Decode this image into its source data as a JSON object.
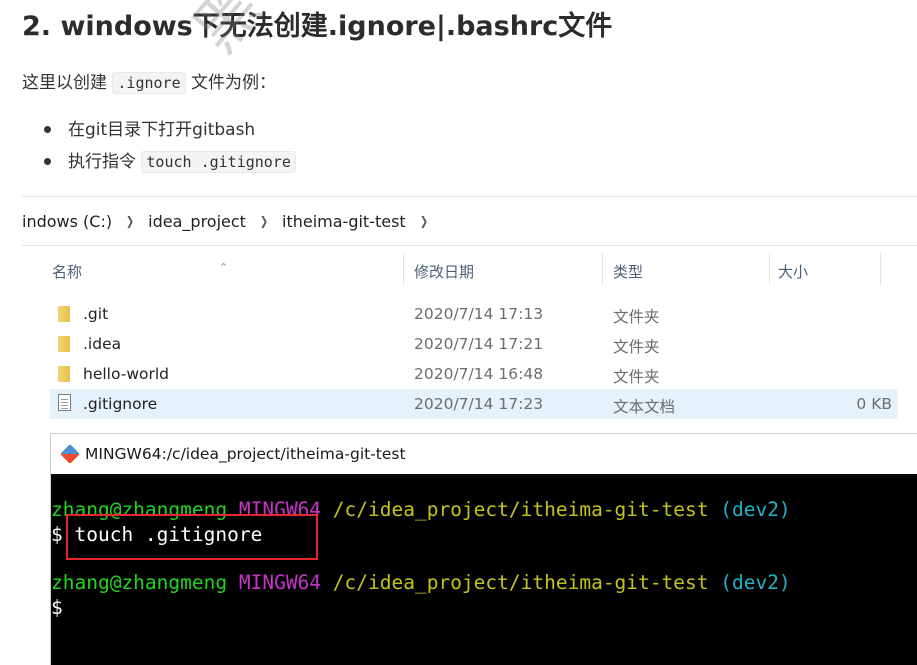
{
  "heading": "2. windows下无法创建.ignore|.bashrc文件",
  "intro": {
    "before": "这里以创建 ",
    "code": ".ignore",
    "after": " 文件为例："
  },
  "bullets": [
    {
      "text": "在git目录下打开gitbash",
      "code": ""
    },
    {
      "text": "执行指令 ",
      "code": "touch .gitignore"
    }
  ],
  "watermark": "黑马程序",
  "explorer": {
    "breadcrumb": [
      "indows (C:)",
      "idea_project",
      "itheima-git-test"
    ],
    "columns": {
      "name": "名称",
      "date": "修改日期",
      "type": "类型",
      "size": "大小"
    },
    "rows": [
      {
        "name": ".git",
        "date": "2020/7/14 17:13",
        "type": "文件夹",
        "size": "",
        "kind": "folder"
      },
      {
        "name": ".idea",
        "date": "2020/7/14 17:21",
        "type": "文件夹",
        "size": "",
        "kind": "folder"
      },
      {
        "name": "hello-world",
        "date": "2020/7/14 16:48",
        "type": "文件夹",
        "size": "",
        "kind": "folder"
      },
      {
        "name": ".gitignore",
        "date": "2020/7/14 17:23",
        "type": "文本文档",
        "size": "0 KB",
        "kind": "file"
      }
    ]
  },
  "terminal": {
    "title": "MINGW64:/c/idea_project/itheima-git-test",
    "prompt1": {
      "user": "zhang@zhangmeng",
      "sys": "MINGW64",
      "path": "/c/idea_project/itheima-git-test",
      "branch": "(dev2)"
    },
    "command": "$ touch .gitignore",
    "prompt2": {
      "user": "zhang@zhangmeng",
      "sys": "MINGW64",
      "path": "/c/idea_project/itheima-git-test",
      "branch": "(dev2)"
    },
    "cursor_line": "$"
  },
  "colors": {
    "term_user": "#1fd61f",
    "term_sys": "#c732c7",
    "term_path": "#c3c31e",
    "term_branch": "#23b1c8",
    "highlight_box": "#e5262c",
    "selected_row": "#e5f1fb"
  }
}
